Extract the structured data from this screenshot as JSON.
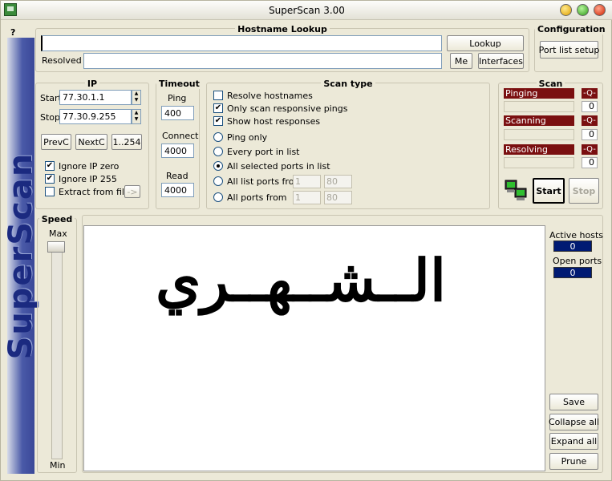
{
  "window": {
    "title": "SuperScan 3.00"
  },
  "help": {
    "label": "?"
  },
  "sidebar": {
    "brand": "SuperScan"
  },
  "hostname": {
    "title": "Hostname Lookup",
    "lookup": "Lookup",
    "resolved_label": "Resolved",
    "me": "Me",
    "interfaces": "Interfaces",
    "input": "",
    "resolved": ""
  },
  "configuration": {
    "title": "Configuration",
    "port_list_setup": "Port list setup"
  },
  "ip": {
    "title": "IP",
    "start_label": "Start",
    "start": "77.30.1.1",
    "stop_label": "Stop",
    "stop": "77.30.9.255",
    "prevc": "PrevC",
    "nextc": "NextC",
    "range": "1..254",
    "ignore_zero": "Ignore IP zero",
    "ignore_255": "Ignore IP 255",
    "extract": "Extract from file",
    "extract_btn": "->"
  },
  "timeout": {
    "title": "Timeout",
    "ping_label": "Ping",
    "ping": "400",
    "connect_label": "Connect",
    "connect": "4000",
    "read_label": "Read",
    "read": "4000"
  },
  "scantype": {
    "title": "Scan type",
    "resolve_hostnames": "Resolve hostnames",
    "only_responsive": "Only scan responsive pings",
    "show_host": "Show host responses",
    "ping_only": "Ping only",
    "every_port": "Every port in list",
    "all_selected": "All selected ports in list",
    "all_list_from": "All list ports from",
    "all_ports_from": "All ports from",
    "from1": "1",
    "to1": "80",
    "from2": "1",
    "to2": "80"
  },
  "scan": {
    "title": "Scan",
    "pinging": "Pinging",
    "scanning": "Scanning",
    "resolving": "Resolving",
    "q": "-Q-",
    "count_pinging": "0",
    "count_scanning": "0",
    "count_resolving": "0",
    "start": "Start",
    "stop": "Stop"
  },
  "speed": {
    "title": "Speed",
    "max": "Max",
    "min": "Min"
  },
  "results": {
    "active_hosts_label": "Active hosts",
    "active_hosts": "0",
    "open_ports_label": "Open ports",
    "open_ports": "0",
    "save": "Save",
    "collapse": "Collapse all",
    "expand": "Expand all",
    "prune": "Prune",
    "arabic_text": "الــشــهــري"
  }
}
